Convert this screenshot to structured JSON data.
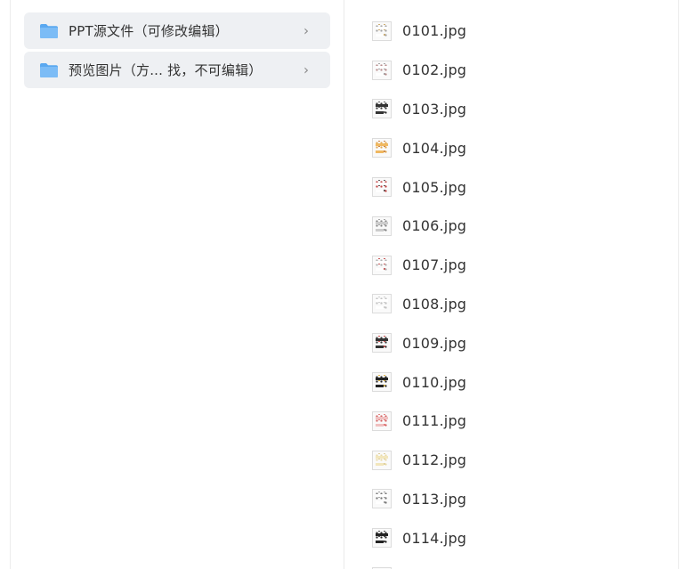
{
  "folders": [
    {
      "label": "PPT源文件（可修改编辑）",
      "icon": "folder-icon",
      "chevron": "›"
    },
    {
      "label": "预览图片（方...  找，不可编辑）",
      "icon": "folder-icon",
      "chevron": "›"
    }
  ],
  "files": [
    {
      "name": "0101.jpg",
      "colors": [
        "#9a9a9a",
        "#c8a25a",
        "#ffffff"
      ]
    },
    {
      "name": "0102.jpg",
      "colors": [
        "#b08080",
        "#999999",
        "#ffffff"
      ]
    },
    {
      "name": "0103.jpg",
      "colors": [
        "#222222",
        "#555555",
        "#333333"
      ]
    },
    {
      "name": "0104.jpg",
      "colors": [
        "#e0a040",
        "#c07030",
        "#f0b860"
      ]
    },
    {
      "name": "0105.jpg",
      "colors": [
        "#c03030",
        "#444444",
        "#ffffff"
      ]
    },
    {
      "name": "0106.jpg",
      "colors": [
        "#777777",
        "#999999",
        "#cccccc"
      ]
    },
    {
      "name": "0107.jpg",
      "colors": [
        "#aaaaaa",
        "#c04040",
        "#ffffff"
      ]
    },
    {
      "name": "0108.jpg",
      "colors": [
        "#bbbbbb",
        "#cccccc",
        "#ffffff"
      ]
    },
    {
      "name": "0109.jpg",
      "colors": [
        "#222222",
        "#d04040",
        "#333333"
      ]
    },
    {
      "name": "0110.jpg",
      "colors": [
        "#111111",
        "#e0b030",
        "#222222"
      ]
    },
    {
      "name": "0111.jpg",
      "colors": [
        "#d05050",
        "#e07070",
        "#f0c0c0"
      ]
    },
    {
      "name": "0112.jpg",
      "colors": [
        "#e8d8a0",
        "#d8c890",
        "#f2e6bc"
      ]
    },
    {
      "name": "0113.jpg",
      "colors": [
        "#666666",
        "#999999",
        "#ffffff"
      ]
    },
    {
      "name": "0114.jpg",
      "colors": [
        "#111111",
        "#333333",
        "#222222"
      ]
    },
    {
      "name": "",
      "colors": [
        "#999999",
        "#bbbbbb",
        "#ffffff"
      ]
    }
  ]
}
